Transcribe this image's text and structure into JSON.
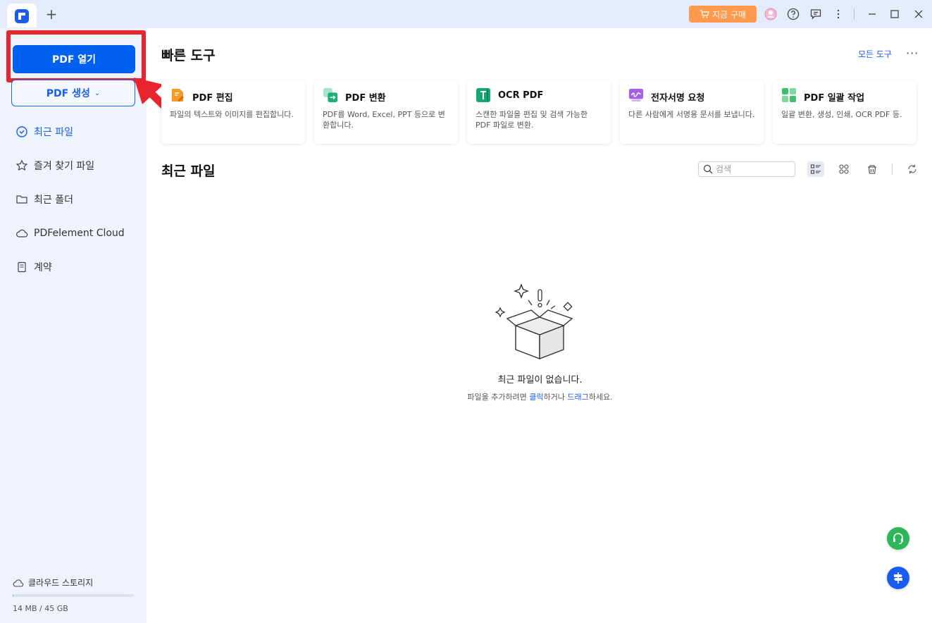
{
  "titlebar": {
    "buy_label": "지금 구매",
    "icons": [
      "cart-icon",
      "avatar",
      "help-icon",
      "feedback-icon",
      "menu-dots-icon",
      "minimize-icon",
      "maximize-icon",
      "close-icon"
    ]
  },
  "sidebar": {
    "open_pdf": "PDF 열기",
    "create_pdf": "PDF 생성",
    "items": [
      {
        "label": "최근 파일",
        "icon": "clock-icon",
        "active": true
      },
      {
        "label": "즐겨 찾기 파일",
        "icon": "star-icon",
        "active": false
      },
      {
        "label": "최근 폴더",
        "icon": "folder-icon",
        "active": false
      },
      {
        "label": "PDFelement Cloud",
        "icon": "cloud-icon",
        "active": false
      },
      {
        "label": "계약",
        "icon": "document-icon",
        "active": false
      }
    ],
    "storage": {
      "label": "클라우드 스토리지",
      "usage": "14 MB / 45 GB",
      "fraction": 0.0003
    }
  },
  "quick_tools": {
    "title": "빠른 도구",
    "all_tools": "모든 도구",
    "cards": [
      {
        "name": "PDF 편집",
        "desc": "파일의 텍스트와 이미지를 편집합니다.",
        "color": "#f59a23"
      },
      {
        "name": "PDF 변환",
        "desc": "PDF를 Word, Excel, PPT 등으로 변환합니다.",
        "color": "#1fae7a"
      },
      {
        "name": "OCR PDF",
        "desc": "스캔한 파일을 편집 및 검색 가능한 PDF 파일로 변환.",
        "color": "#16a574"
      },
      {
        "name": "전자서명 요청",
        "desc": "다른 사람에게 서명용 문서를 보냅니다.",
        "color": "#a461e6"
      },
      {
        "name": "PDF 일괄 작업",
        "desc": "일괄 변환, 생성, 인쇄, OCR PDF 등.",
        "color": "#3fbf6c"
      }
    ]
  },
  "recent": {
    "title": "최근 파일",
    "search_placeholder": "검색",
    "empty_title": "최근 파일이 없습니다.",
    "empty_sub_1": "파일을 추가하려면 ",
    "empty_link_1": "클릭",
    "empty_sub_2": "하거나 ",
    "empty_link_2": "드래그",
    "empty_sub_3": "하세요."
  }
}
